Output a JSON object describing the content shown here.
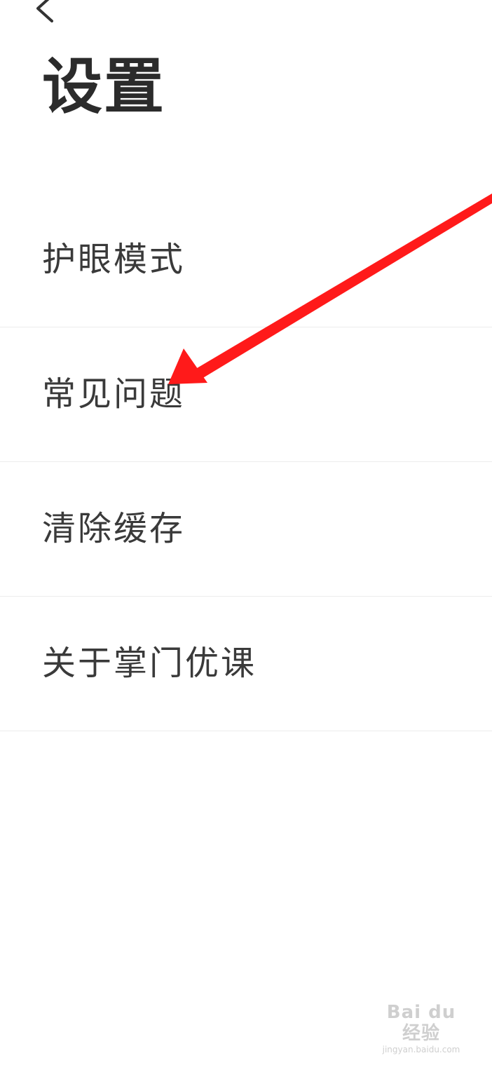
{
  "header": {
    "back_icon": "chevron-left-icon",
    "title": "设置"
  },
  "settings": {
    "items": [
      {
        "label": "护眼模式"
      },
      {
        "label": "常见问题"
      },
      {
        "label": "清除缓存"
      },
      {
        "label": "关于掌门优课"
      }
    ]
  },
  "annotation": {
    "arrow_color": "#ff1a1a",
    "points_to": "常见问题"
  },
  "watermark": {
    "logo_text": "Bai du 经验",
    "url": "jingyan.baidu.com"
  }
}
